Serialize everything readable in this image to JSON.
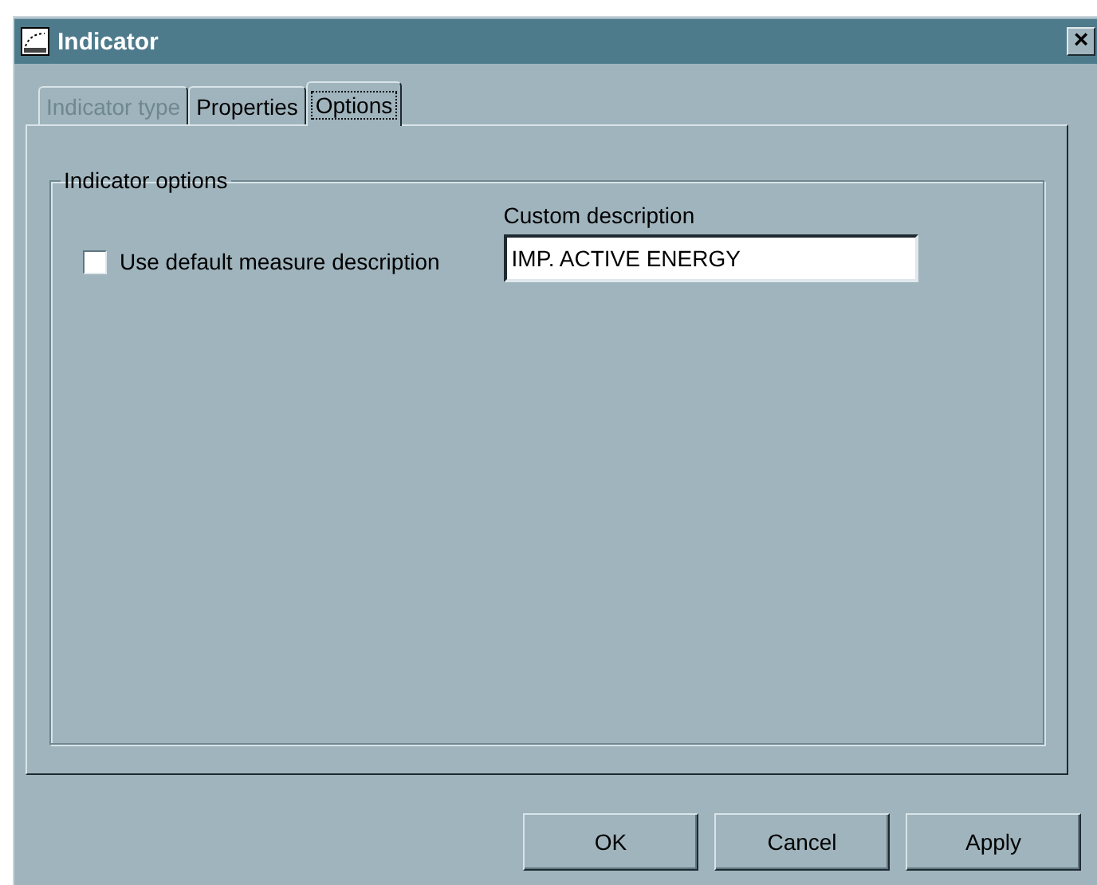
{
  "window": {
    "title": "Indicator",
    "close_icon": "×"
  },
  "tabs": [
    {
      "label": "Indicator type",
      "selected": false,
      "disabled": true
    },
    {
      "label": "Properties",
      "selected": false,
      "disabled": false
    },
    {
      "label": "Options",
      "selected": true,
      "disabled": false
    }
  ],
  "group": {
    "title": "Indicator options",
    "checkbox": {
      "label": "Use default measure description",
      "checked": false
    },
    "field": {
      "label": "Custom description",
      "value": "IMP. ACTIVE ENERGY"
    }
  },
  "buttons": [
    "OK",
    "Cancel",
    "Apply"
  ]
}
